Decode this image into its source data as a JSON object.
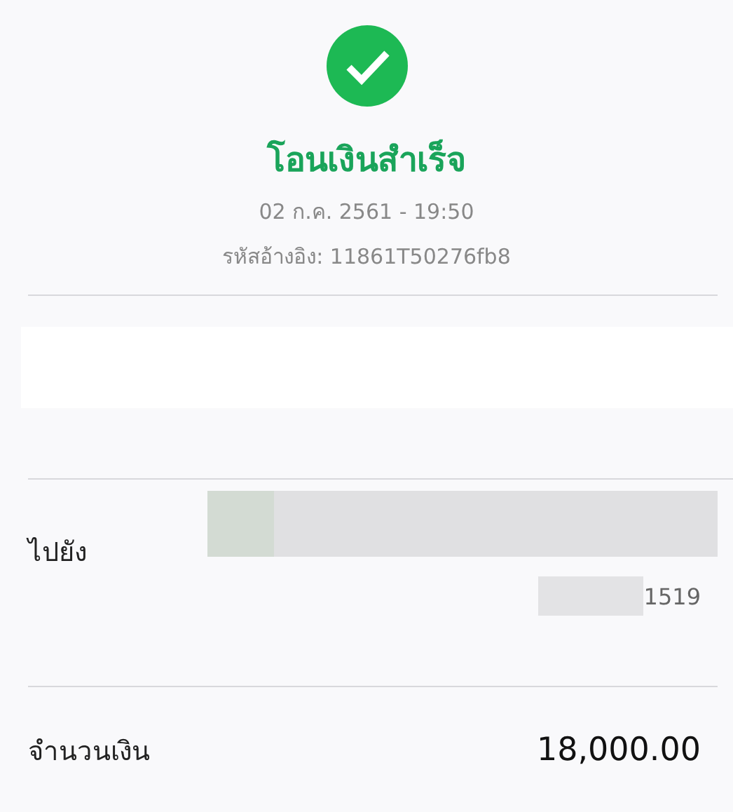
{
  "status": {
    "kind": "success",
    "title": "โอนเงินสำเร็จ"
  },
  "datetime": "02 ก.ค. 2561 - 19:50",
  "reference": "รหัสอ้างอิง: 11861T50276fb8",
  "recipient": {
    "label": "ไปยัง",
    "account_suffix": "1519"
  },
  "amount": {
    "label": "จำนวนเงิน",
    "value": "18,000.00"
  }
}
